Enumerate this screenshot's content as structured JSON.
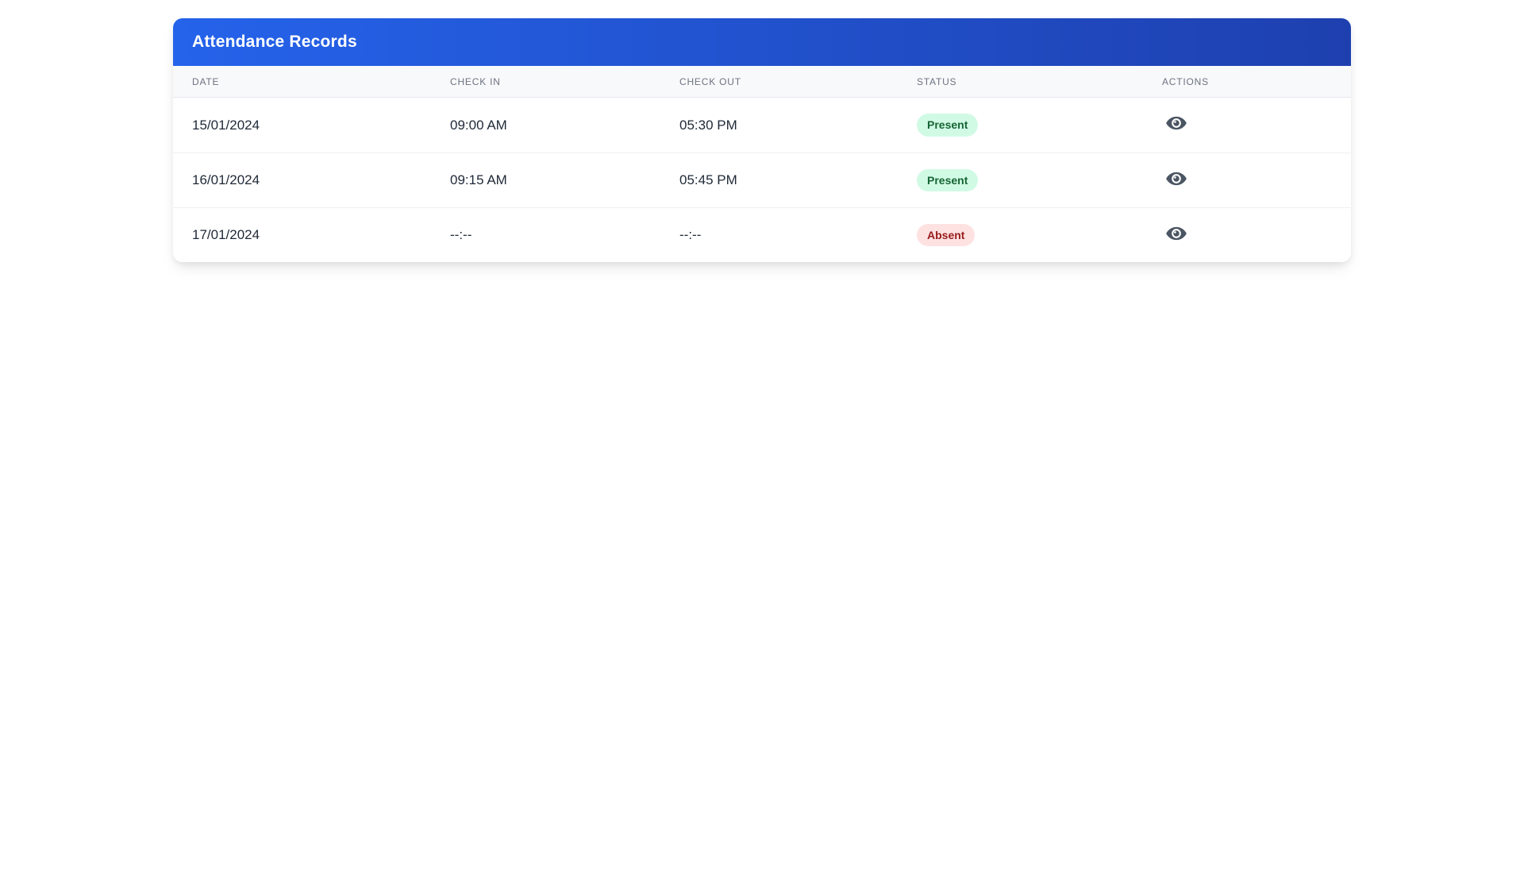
{
  "card": {
    "title": "Attendance Records",
    "header_gradient_from": "#2563eb",
    "header_gradient_to": "#1e40af",
    "title_color": "#ffffff"
  },
  "table": {
    "columns": [
      "DATE",
      "CHECK IN",
      "CHECK OUT",
      "STATUS",
      "ACTIONS"
    ],
    "rows": [
      {
        "date": "15/01/2024",
        "check_in": "09:00 AM",
        "check_out": "05:30 PM",
        "status": "Present",
        "action_icon": "eye-icon"
      },
      {
        "date": "16/01/2024",
        "check_in": "09:15 AM",
        "check_out": "05:45 PM",
        "status": "Present",
        "action_icon": "eye-icon"
      },
      {
        "date": "17/01/2024",
        "check_in": "--:--",
        "check_out": "--:--",
        "status": "Absent",
        "action_icon": "eye-icon"
      }
    ],
    "status_styles": {
      "Present": {
        "bg": "#d1fae5",
        "text": "#166534"
      },
      "Absent": {
        "bg": "#fee2e2",
        "text": "#991b1b"
      }
    },
    "icon_color": "#4b5563"
  }
}
